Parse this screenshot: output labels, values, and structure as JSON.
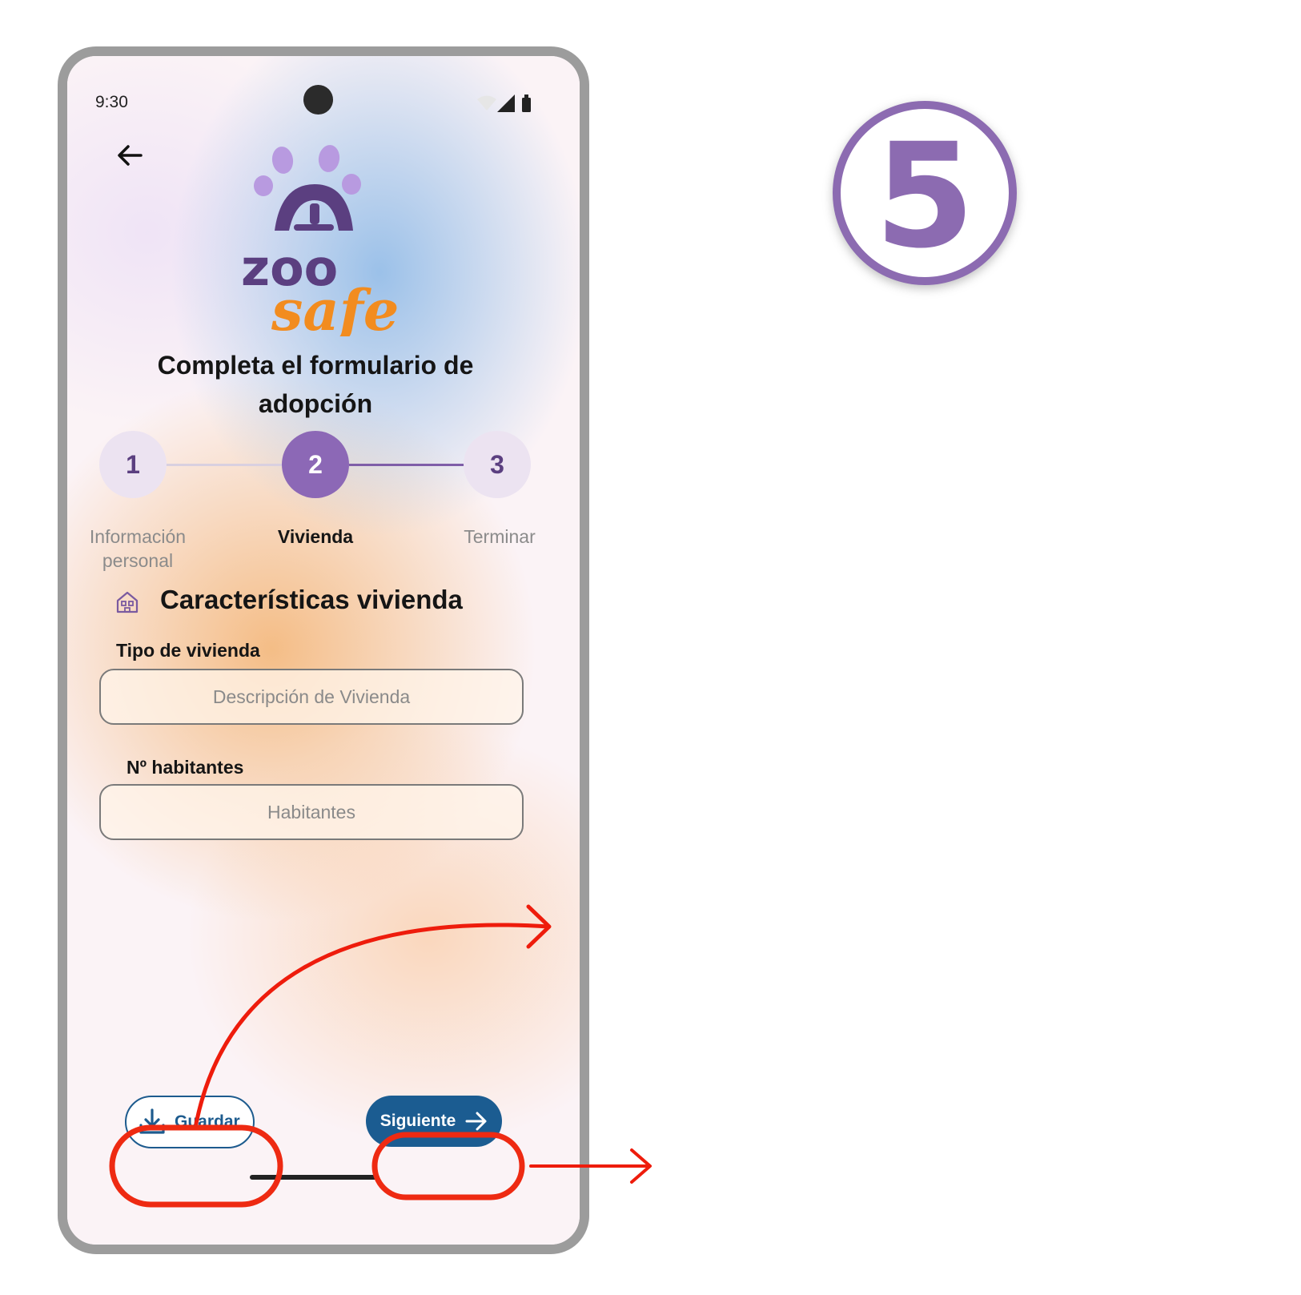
{
  "status_bar": {
    "time": "9:30"
  },
  "logo": {
    "line1": "zoo",
    "line2": "safe"
  },
  "form": {
    "title_line1": "Completa el formulario de",
    "title_line2": "adopción",
    "steps": [
      {
        "number": "1",
        "label_line1": "Información",
        "label_line2": "personal"
      },
      {
        "number": "2",
        "label_line1": "Vivienda",
        "label_line2": ""
      },
      {
        "number": "3",
        "label_line1": "Terminar",
        "label_line2": ""
      }
    ],
    "section_title": "Características vivienda",
    "fields": [
      {
        "label": "Tipo de vivienda",
        "placeholder": "Descripción de Vivienda"
      },
      {
        "label": "Nº habitantes",
        "placeholder": "Habitantes"
      }
    ]
  },
  "buttons": {
    "save_label": "Guardar",
    "next_label": "Siguiente"
  },
  "annotation": {
    "step_number": "5"
  },
  "colors": {
    "brand_purple": "#8c6bb1",
    "logo_orange": "#f28c1f",
    "primary_blue": "#1b5c91",
    "highlight_red": "#ee2a12"
  }
}
